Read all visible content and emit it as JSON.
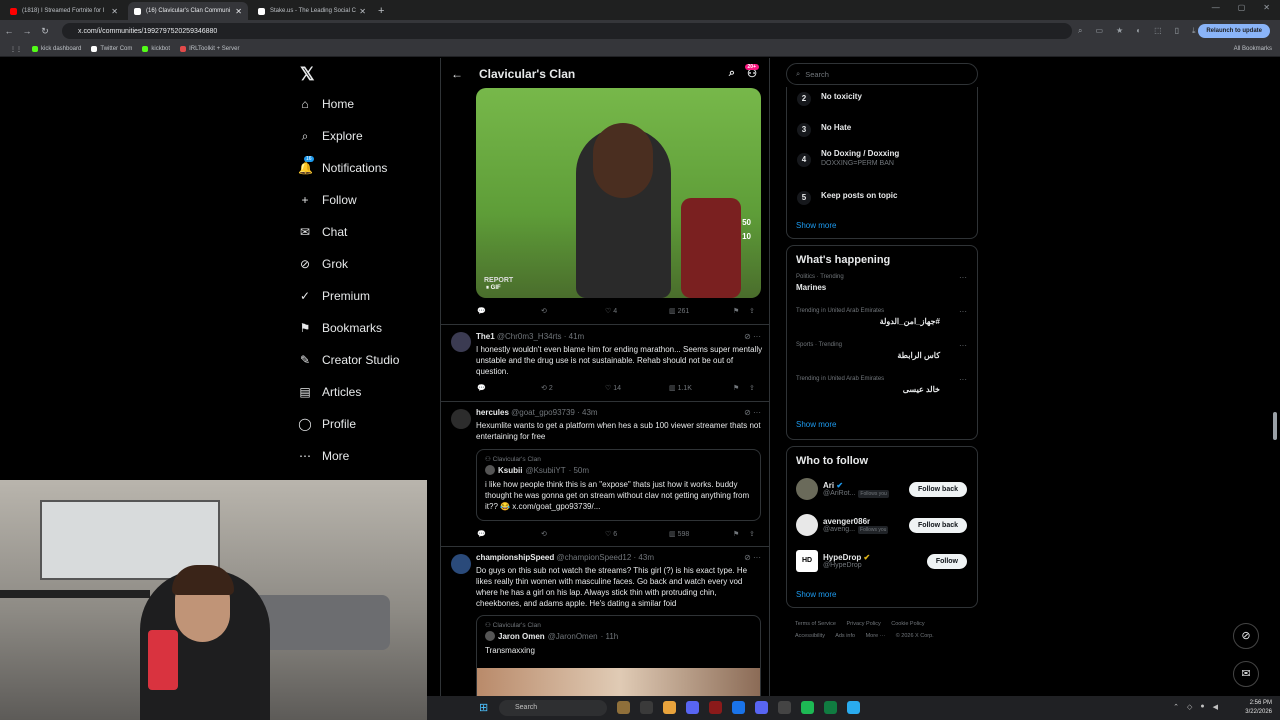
{
  "browser": {
    "tabs": [
      {
        "label": "(1818) I Streamed Fortnite for I",
        "color": "#ff0000",
        "active": false
      },
      {
        "label": "(16) Clavicular's Clan Communi",
        "color": "#ffffff",
        "active": true
      },
      {
        "label": "Stake.us - The Leading Social C",
        "color": "#ffffff",
        "active": false
      }
    ],
    "url": "x.com/i/communities/1992797520259346880",
    "relaunch_label": "Relaunch to update",
    "bookmarks": [
      {
        "label": "kick dashboard",
        "color": "#53fc18"
      },
      {
        "label": "Twitter Com",
        "color": "#ffffff"
      },
      {
        "label": "kickbot",
        "color": "#53fc18"
      },
      {
        "label": "IRLToolkit + Server",
        "color": "#e24a4a"
      }
    ],
    "all_bookmarks": "All Bookmarks"
  },
  "nav": {
    "logo": "𝕏",
    "notifications_badge": "16",
    "items": [
      {
        "label": "Home",
        "icon": "⌂"
      },
      {
        "label": "Explore",
        "icon": "⌕"
      },
      {
        "label": "Notifications",
        "icon": "🔔"
      },
      {
        "label": "Follow",
        "icon": "+"
      },
      {
        "label": "Chat",
        "icon": "✉"
      },
      {
        "label": "Grok",
        "icon": "⊘"
      },
      {
        "label": "Premium",
        "icon": "✓"
      },
      {
        "label": "Bookmarks",
        "icon": "⚑"
      },
      {
        "label": "Creator Studio",
        "icon": "✎"
      },
      {
        "label": "Articles",
        "icon": "▤"
      },
      {
        "label": "Profile",
        "icon": "◯"
      },
      {
        "label": "More",
        "icon": "⋯"
      }
    ]
  },
  "community": {
    "title": "Clavicular's Clan",
    "badge": "20+",
    "gif_numbers": [
      "50",
      "10"
    ],
    "gif_tag": "GIF",
    "gif_report": "REPORT",
    "first_post_actions": {
      "likes": "4",
      "views": "261"
    },
    "posts": [
      {
        "name": "The1",
        "handle": "@Chr0m3_H34rts",
        "time": "· 41m",
        "text": "I honestly wouldn't even blame him for ending marathon... Seems super mentally unstable and the drug use is not sustainable. Rehab should not be out of question.",
        "retweets": "2",
        "likes": "14",
        "views": "1.1K"
      },
      {
        "name": "hercules",
        "handle": "@goat_gpo93739",
        "time": "· 43m",
        "text": "Hexumlite wants to get a platform when hes a sub 100 viewer streamer thats not entertaining for free",
        "quote_community": "Clavicular's Clan",
        "quote_name": "Ksubii",
        "quote_handle": "@KsubiiYT",
        "quote_time": "· 50m",
        "quote_text": "i like how people think this is an \"expose\" thats just how it works. buddy thought he was gonna get on stream without clav not getting anything from it?? 😂 x.com/goat_gpo93739/...",
        "likes": "6",
        "views": "598"
      },
      {
        "name": "championshipSpeed",
        "handle": "@championSpeed12",
        "time": "· 43m",
        "text": "Do guys on this sub not watch the streams? This girl (?) is his exact type. He likes really thin women with masculine faces. Go back and watch every vod where he has a girl on his lap. Always stick thin with protruding chin, cheekbones, and adams apple. He's dating a similar foid",
        "quote_community": "Clavicular's Clan",
        "quote_name": "Jaron Omen",
        "quote_handle": "@JaronOmen",
        "quote_time": "· 11h",
        "quote_text": "Transmaxxing"
      }
    ]
  },
  "sidebar": {
    "search_placeholder": "Search",
    "rules": [
      {
        "n": "2",
        "title": "No toxicity",
        "sub": ""
      },
      {
        "n": "3",
        "title": "No Hate",
        "sub": ""
      },
      {
        "n": "4",
        "title": "No Doxing / Doxxing",
        "sub": "DOXXING=PERM BAN"
      },
      {
        "n": "5",
        "title": "Keep posts on topic",
        "sub": ""
      }
    ],
    "show_more": "Show more",
    "happening_title": "What's happening",
    "trends": [
      {
        "ctx": "Politics · Trending",
        "name": "Marines",
        "rtl": false
      },
      {
        "ctx": "Trending in United Arab Emirates",
        "name": "#جهاز_امن_الدولة",
        "rtl": true
      },
      {
        "ctx": "Sports · Trending",
        "name": "كاس الرابطة",
        "rtl": true
      },
      {
        "ctx": "Trending in United Arab Emirates",
        "name": "خالد عيسى",
        "rtl": true
      }
    ],
    "who_title": "Who to follow",
    "follows": [
      {
        "name": "Ari",
        "handle": "@AriRot...",
        "follows_you": "Follows you",
        "button": "Follow back"
      },
      {
        "name": "avenger086r",
        "handle": "@aveng...",
        "follows_you": "Follows you",
        "button": "Follow back"
      },
      {
        "name": "HypeDrop",
        "handle": "@HypeDrop",
        "follows_you": "",
        "button": "Follow"
      }
    ],
    "footer": [
      "Terms of Service",
      "Privacy Policy",
      "Cookie Policy",
      "Accessibility",
      "Ads info",
      "More ···",
      "© 2026 X Corp."
    ]
  },
  "taskbar": {
    "search": "Search",
    "time": "2:56 PM",
    "date": "3/22/2026"
  }
}
